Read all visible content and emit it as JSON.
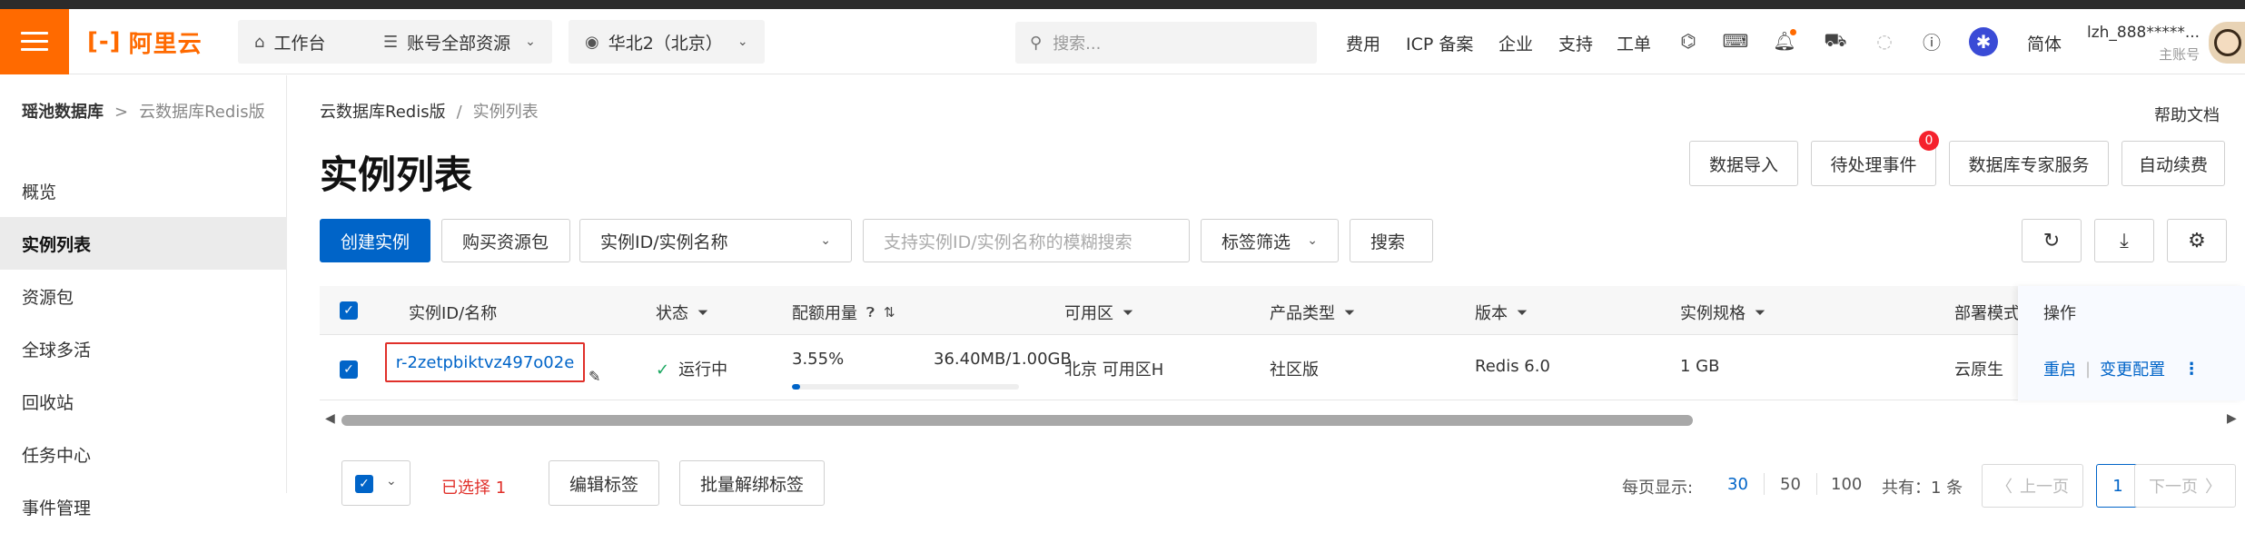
{
  "topbar": {
    "logo_text": "阿里云",
    "workbench_label": "工作台",
    "resource_label": "账号全部资源",
    "region_label": "华北2（北京）",
    "search_placeholder": "搜索...",
    "nav": [
      "费用",
      "ICP 备案",
      "企业",
      "支持",
      "工单"
    ],
    "lang_label": "简体",
    "user_name": "lzh_888*****...",
    "user_role": "主账号",
    "colors": {
      "brand": "#ff6a00",
      "primary": "#0064c8"
    }
  },
  "sidebar": {
    "breadcrumb_root": "瑶池数据库",
    "breadcrumb_sep": ">",
    "breadcrumb_current": "云数据库Redis版",
    "items": [
      {
        "label": "概览",
        "active": false
      },
      {
        "label": "实例列表",
        "active": true
      },
      {
        "label": "资源包",
        "active": false
      },
      {
        "label": "全球多活",
        "active": false
      },
      {
        "label": "回收站",
        "active": false
      },
      {
        "label": "任务中心",
        "active": false
      },
      {
        "label": "事件管理",
        "active": false
      }
    ]
  },
  "main": {
    "breadcrumb_root": "云数据库Redis版",
    "breadcrumb_sep": "/",
    "breadcrumb_current": "实例列表",
    "help_label": "帮助文档",
    "title": "实例列表",
    "actions": {
      "import_label": "数据导入",
      "pending_label": "待处理事件",
      "pending_count": "0",
      "expert_label": "数据库专家服务",
      "renew_label": "自动续费"
    },
    "toolbar": {
      "create_label": "创建实例",
      "buy_label": "购买资源包",
      "filter_field": "实例ID/实例名称",
      "filter_placeholder": "支持实例ID/实例名称的模糊搜索",
      "tag_filter_label": "标签筛选",
      "search_label": "搜索"
    },
    "table": {
      "columns": [
        "实例ID/名称",
        "状态",
        "配额用量",
        "可用区",
        "产品类型",
        "版本",
        "实例规格",
        "部署模式",
        "操作"
      ],
      "rows": [
        {
          "id": "r-2zetpbiktvz497o02e",
          "status": "运行中",
          "usage_percent": "3.55%",
          "usage_amount": "36.40MB/1.00GB",
          "usage_fraction": 0.0355,
          "zone": "北京 可用区H",
          "product_type": "社区版",
          "version": "Redis 6.0",
          "spec": "1 GB",
          "deploy_mode": "云原生",
          "op_restart": "重启",
          "op_change": "变更配置"
        }
      ]
    },
    "footer": {
      "selected_label": "已选择 1",
      "edit_tags_label": "编辑标签",
      "unbind_tags_label": "批量解绑标签",
      "per_page_label": "每页显示:",
      "page_sizes": [
        "30",
        "50",
        "100"
      ],
      "total_label": "共有：1 条",
      "prev_label": "上一页",
      "current_page": "1",
      "next_label": "下一页"
    }
  }
}
